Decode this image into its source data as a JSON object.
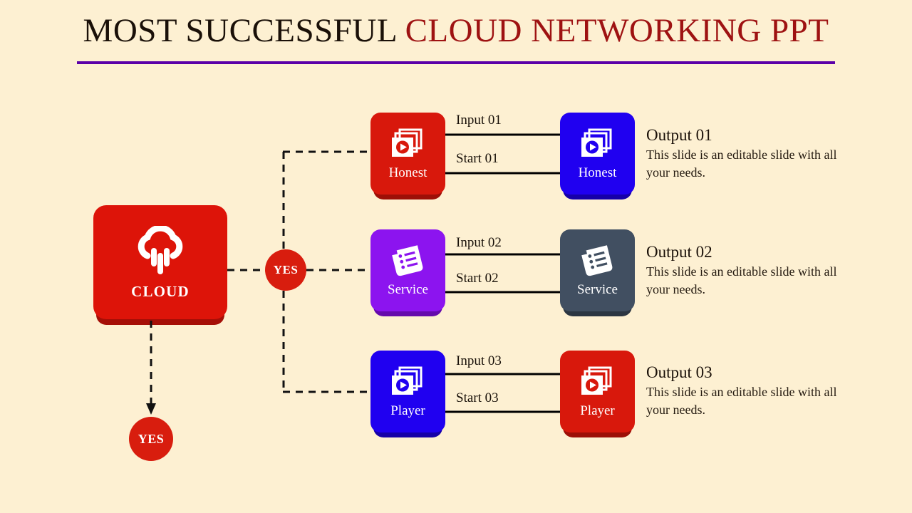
{
  "slide": {
    "background_color": "#fdf0d2",
    "title": {
      "part_black": "MOST SUCCESSFUL ",
      "part_red": "CLOUD NETWORKING PPT",
      "black_color": "#1a1008",
      "red_color": "#9e1212",
      "rule_color": "#5b00a8"
    }
  },
  "source_node": {
    "label": "CLOUD",
    "icon": "cloud-rain-icon",
    "color": "#dd1409"
  },
  "decision_nodes": [
    {
      "label": "YES",
      "name": "yes-branch-badge",
      "color": "#d81d0e"
    },
    {
      "label": "YES",
      "name": "yes-bottom-badge",
      "color": "#d81d0e"
    }
  ],
  "rows": [
    {
      "mid": {
        "label": "Honest",
        "icon": "video-stack-icon",
        "color": "#d8180c"
      },
      "right": {
        "label": "Honest",
        "icon": "video-stack-icon",
        "color": "#2000f0"
      },
      "edge_top": "Input 01",
      "edge_bottom": "Start 01",
      "output": {
        "title": "Output 01",
        "description": "This slide is an editable slide with all your needs."
      }
    },
    {
      "mid": {
        "label": "Service",
        "icon": "document-list-icon",
        "color": "#8c14ef"
      },
      "right": {
        "label": "Service",
        "icon": "document-list-icon",
        "color": "#414f61"
      },
      "edge_top": "Input 02",
      "edge_bottom": "Start 02",
      "output": {
        "title": "Output 02",
        "description": "This slide is an editable slide with all your needs."
      }
    },
    {
      "mid": {
        "label": "Player",
        "icon": "video-stack-icon",
        "color": "#2000f0"
      },
      "right": {
        "label": "Player",
        "icon": "video-stack-icon",
        "color": "#d8180c"
      },
      "edge_top": "Input 03",
      "edge_bottom": "Start 03",
      "output": {
        "title": "Output 03",
        "description": "This slide is an editable slide with all your needs."
      }
    }
  ]
}
